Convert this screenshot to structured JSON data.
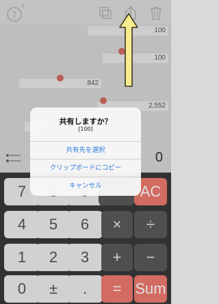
{
  "toolbar": {
    "help_glyph": "?",
    "help_count": "1",
    "icons": [
      "help-icon",
      "copy-icon",
      "share-icon",
      "trash-icon"
    ]
  },
  "history": [
    "100",
    "100",
    "842",
    "2,552"
  ],
  "display": {
    "value": "0"
  },
  "keypad": {
    "row1": [
      "7",
      "8",
      "9",
      "−",
      "AC"
    ],
    "row2": [
      "4",
      "5",
      "6",
      "×",
      "÷"
    ],
    "row3": [
      "1",
      "2",
      "3",
      "+",
      "−"
    ],
    "row4": [
      "0",
      "±",
      ".",
      "=",
      "Sum"
    ]
  },
  "dialog": {
    "title": "共有しますか？",
    "message": "[100]",
    "actions": [
      "共有先を選択",
      "クリップボードにコピー",
      "キャンセル"
    ]
  },
  "colors": {
    "accent_red": "#f07a6f",
    "link_blue": "#2b7bd8",
    "arrow_yellow": "#f7ec8e"
  }
}
